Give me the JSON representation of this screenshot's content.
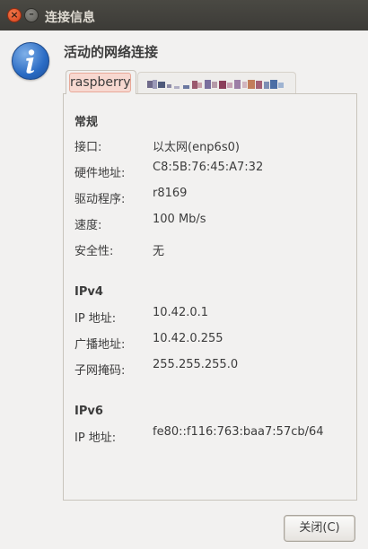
{
  "window": {
    "title": "连接信息",
    "close_glyph": "×",
    "minimize_glyph": "–"
  },
  "heading": "活动的网络连接",
  "tabs": [
    {
      "label": "raspberry",
      "active": true
    },
    {
      "label": "",
      "active": false,
      "obscured": true
    }
  ],
  "sections": {
    "general": {
      "title": "常规",
      "rows": [
        {
          "label": "接口:",
          "value": "以太网(enp6s0)"
        },
        {
          "label": "硬件地址:",
          "value": "C8:5B:76:45:A7:32"
        },
        {
          "label": "驱动程序:",
          "value": "r8169"
        },
        {
          "label": "速度:",
          "value": "100 Mb/s"
        },
        {
          "label": "安全性:",
          "value": "无"
        }
      ]
    },
    "ipv4": {
      "title": "IPv4",
      "rows": [
        {
          "label": "IP 地址:",
          "value": "10.42.0.1"
        },
        {
          "label": "广播地址:",
          "value": "10.42.0.255"
        },
        {
          "label": "子网掩码:",
          "value": "255.255.255.0"
        }
      ]
    },
    "ipv6": {
      "title": "IPv6",
      "rows": [
        {
          "label": "IP 地址:",
          "value": "fe80::f116:763:baa7:57cb/64"
        }
      ]
    }
  },
  "buttons": {
    "close_label": "关闭(C)"
  },
  "icons": {
    "window_close": "close-icon",
    "window_minimize": "minimize-icon",
    "info": "info-icon"
  },
  "colors": {
    "titlebar": "#3c3b37",
    "close_button": "#e1582a",
    "active_tab_highlight": "#f7d8d0",
    "info_icon": "#2a6bc4"
  }
}
